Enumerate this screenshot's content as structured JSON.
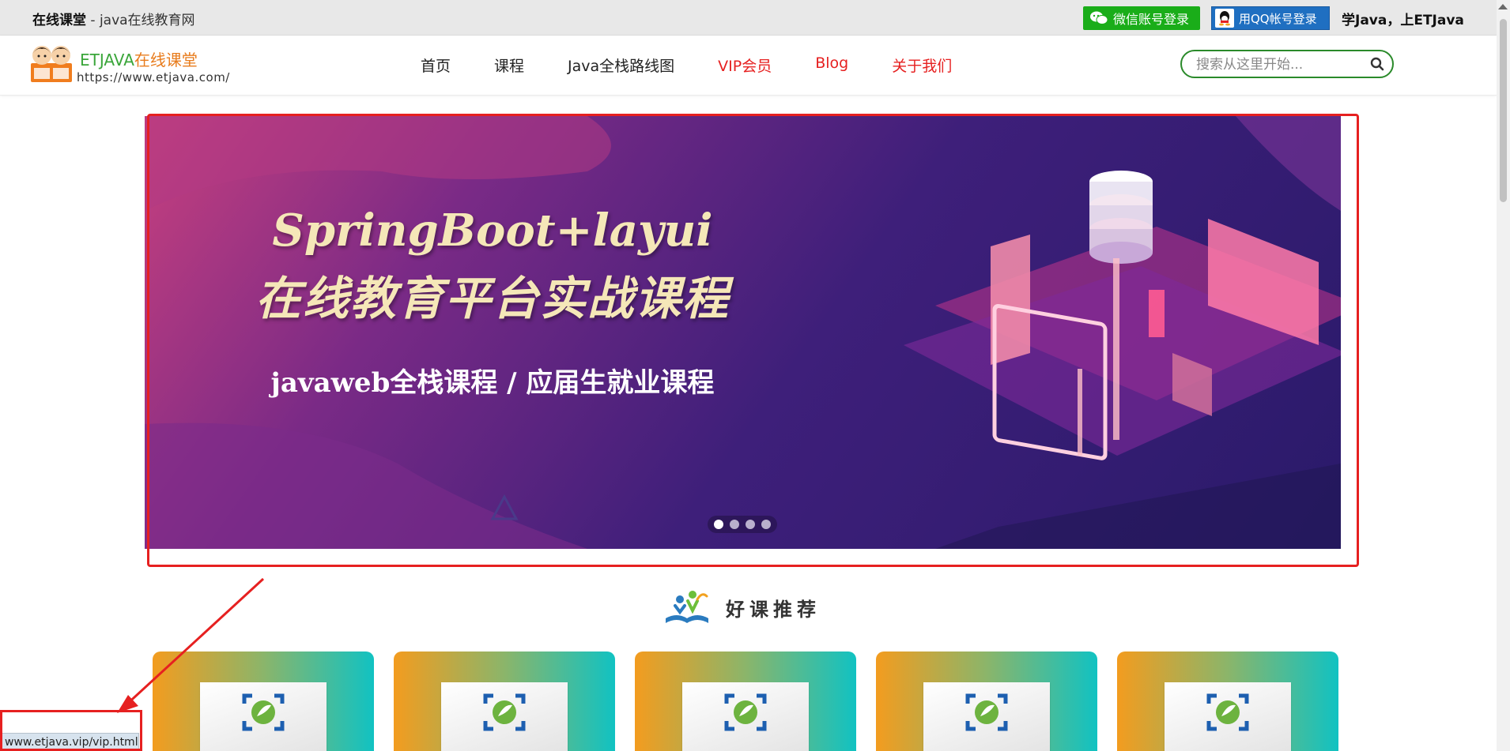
{
  "topbar": {
    "brand_bold": "在线课堂",
    "brand_rest": " - java在线教育网",
    "wechat_login": "微信账号登录",
    "qq_login": "用QQ帐号登录",
    "slogan": "学Java，上ETJava"
  },
  "logo": {
    "name_en": "ETJAVA",
    "name_cn": "在线课堂",
    "url": "https://www.etjava.com/"
  },
  "nav": [
    {
      "label": "首页",
      "highlight": false
    },
    {
      "label": "课程",
      "highlight": false
    },
    {
      "label": "Java全栈路线图",
      "highlight": false
    },
    {
      "label": "VIP会员",
      "highlight": true
    },
    {
      "label": "Blog",
      "highlight": true
    },
    {
      "label": "关于我们",
      "highlight": true
    }
  ],
  "search": {
    "placeholder": "搜索从这里开始..."
  },
  "banner": {
    "line1": "SpringBoot+layui",
    "line2": "在线教育平台实战课程",
    "line3": "javaweb全栈课程 / 应届生就业课程",
    "slide_count": 4,
    "active_slide": 1
  },
  "section": {
    "title": "好课推荐"
  },
  "cards": [
    {
      "icon": "spring-logo-icon"
    },
    {
      "icon": "spring-logo-icon"
    },
    {
      "icon": "spring-logo-icon"
    },
    {
      "icon": "spring-logo-icon"
    },
    {
      "icon": "spring-logo-icon"
    }
  ],
  "status_bar": {
    "url": "www.etjava.vip/vip.html"
  },
  "colors": {
    "accent_red": "#e62020",
    "wechat_green": "#1aad19",
    "qq_blue": "#1f6fc1",
    "search_border": "#2a8a2a"
  }
}
